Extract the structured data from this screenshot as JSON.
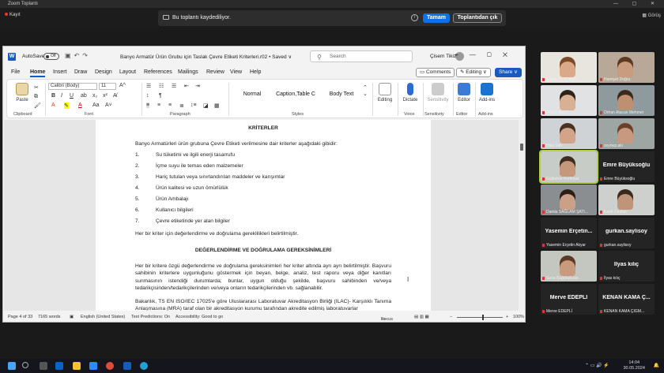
{
  "zoom": {
    "window_title": "Zoom Toplantı",
    "recording_label": "Kayıt",
    "banner_message": "Bu toplantı kaydediliyor.",
    "ok_button": "Tamam",
    "leave_button": "Toplantıdan çık",
    "view_label": "Görüş"
  },
  "word": {
    "autosave_label": "AutoSave",
    "autosave_state": "Off",
    "doc_title": "Banyo Armatür Ürün Grubu için Taslak Çevre Etiketi Kriterleri.r02 • Saved ∨",
    "search_placeholder": "Search",
    "user_name": "Çisem Tikiz",
    "menu": [
      "File",
      "Home",
      "Insert",
      "Draw",
      "Design",
      "Layout",
      "References",
      "Mailings",
      "Review",
      "View",
      "Help"
    ],
    "comments_button": "Comments",
    "editing_button": "Editing",
    "share_button": "Share",
    "ribbon": {
      "paste": "Paste",
      "font_name": "Calibri (Body)",
      "font_size": "11",
      "styles": [
        "Normal",
        "Caption,Table C",
        "Body Text"
      ],
      "editing": "Editing",
      "dictate": "Dictate",
      "sensitivity": "Sensitivity",
      "editor": "Editor",
      "addins": "Add-ins",
      "groups": [
        "Clipboard",
        "Font",
        "Paragraph",
        "Styles",
        "Voice",
        "Sensitivity",
        "Editor",
        "Add-ins"
      ]
    },
    "document": {
      "heading1": "KRİTERLER",
      "intro": "Banyo Armatürleri ürün grubuna Çevre Etiketi verilmesine dair kriterler aşağıdaki gibidir:",
      "criteria": [
        {
          "num": "1.",
          "text": "Su tüketimi ve ilgili enerji tasarrufu"
        },
        {
          "num": "2.",
          "text": "İçme suyu ile temas eden malzemeler"
        },
        {
          "num": "3.",
          "text": "Hariç tutulan veya sınırlandırılan maddeler ve karışımlar"
        },
        {
          "num": "4.",
          "text": "Ürün kalitesi ve uzun ömürlülük"
        },
        {
          "num": "5.",
          "text": "Ürün Ambalajı"
        },
        {
          "num": "6.",
          "text": "Kullanıcı bilgileri"
        },
        {
          "num": "7.",
          "text": "Çevre etiketinde yer alan bilgiler"
        }
      ],
      "closing": "Her bir kriter için değerlendirme ve doğrulama gereklilikleri belirtilmiştir.",
      "heading2": "DEĞERLENDİRME VE DOĞRULAMA GEREKSİNİMLERİ",
      "para1": "Her bir kritere özgü değerlendirme ve doğrulama gereksinimleri her kriter altında ayrı ayrı belirtilmiştir. Başvuru sahibinin kriterlere uygunluğunu göstermek için beyan, belge, analiz, test raporu veya diğer kanıtları sunmasının istendiği durumlarda; bunlar, uygun olduğu şekilde, başvuru sahibinden ve/veya tedarikçisinden/tedarikçilerinden ve/veya onların tedarikçilerinden vb. sağlanabilir.",
      "para2": "Bakanlık, TS EN ISO/IEC 17025'e göre Uluslararası Laboratuvar Akreditasyon Birliği (ILAC)- Karşılıklı Tanıma Anlaşmasına (MRA) taraf olan bir akreditasyon kurumu tarafından akredite edilmiş laboratuvarlar"
    },
    "status": {
      "page": "Page 4 of 33",
      "words": "7165 words",
      "language": "English (United States)",
      "predictions": "Text Predictions: On",
      "accessibility": "Accessibility: Good to go",
      "focus": "Focus",
      "zoom": "100%"
    }
  },
  "participants": [
    {
      "name": "Büşak Çelik-WWD",
      "video": true,
      "skin": "#d9a98a",
      "hair": "#7a4a2a",
      "bg": "#e8e4de"
    },
    {
      "name": "Hamiyet Doğru",
      "video": true,
      "skin": "#c99c80",
      "hair": "#5a3a20",
      "bg": "#b8a898"
    },
    {
      "name": "WWD-TEC",
      "video": true,
      "skin": "#d8b094",
      "hair": "#2e2218",
      "bg": "#e0e2e4"
    },
    {
      "name": "Orhan Atacan Mehmet",
      "video": true,
      "skin": "#c08f70",
      "hair": "#3a2a1e",
      "bg": "#8f9a9e"
    },
    {
      "name": "Hilal Sarı",
      "video": true,
      "skin": "#d2a58a",
      "hair": "#4a3222",
      "bg": "#cfd3d6"
    },
    {
      "name": "zeynep.akı",
      "video": true,
      "skin": "#c79a80",
      "hair": "#6a4028",
      "bg": "#9ea6a4"
    },
    {
      "name": "Gülbahar Korkmaz",
      "video": true,
      "skin": "#c5987c",
      "hair": "#3e2c1e",
      "bg": "#c8ccc6",
      "active": true
    },
    {
      "name": "Emre Büyüksoğlu",
      "video": false,
      "display": "Emre Büyüksoğlu"
    },
    {
      "name": "Damla SAĞLAM ŞATI...",
      "video": true,
      "skin": "#caa088",
      "hair": "#2a1e16",
      "bg": "#8a8e90"
    },
    {
      "name": "Kadir Ceylan",
      "video": true,
      "skin": "#c09478",
      "hair": "#3a2a1e",
      "bg": "#cdd0cc"
    },
    {
      "name": "Yasemin Erçetin Akyar",
      "video": false,
      "display": "Yasemin Erçetin..."
    },
    {
      "name": "gurkan.saylisoy",
      "video": false,
      "display": "gurkan.saylisoy"
    },
    {
      "name": "Sena Bağdaşlıyan",
      "video": true,
      "skin": "#c89a7e",
      "hair": "#5a3a22",
      "bg": "#c4c6c0"
    },
    {
      "name": "İlyas kılıç",
      "video": false,
      "display": "İlyas kılıç"
    },
    {
      "name": "Merve EDEPLİ",
      "video": false,
      "display": "Merve EDEPLİ"
    },
    {
      "name": "KENAN KAMA ÇIGM...",
      "video": false,
      "display": "KENAN KAMA Ç..."
    }
  ],
  "taskbar": {
    "time": "14:04",
    "date": "30.05.2024"
  },
  "colors": {
    "word_blue": "#185abd",
    "zoom_blue": "#0e71eb",
    "active_speaker": "#b5d334",
    "muted_red": "#dd3333"
  }
}
